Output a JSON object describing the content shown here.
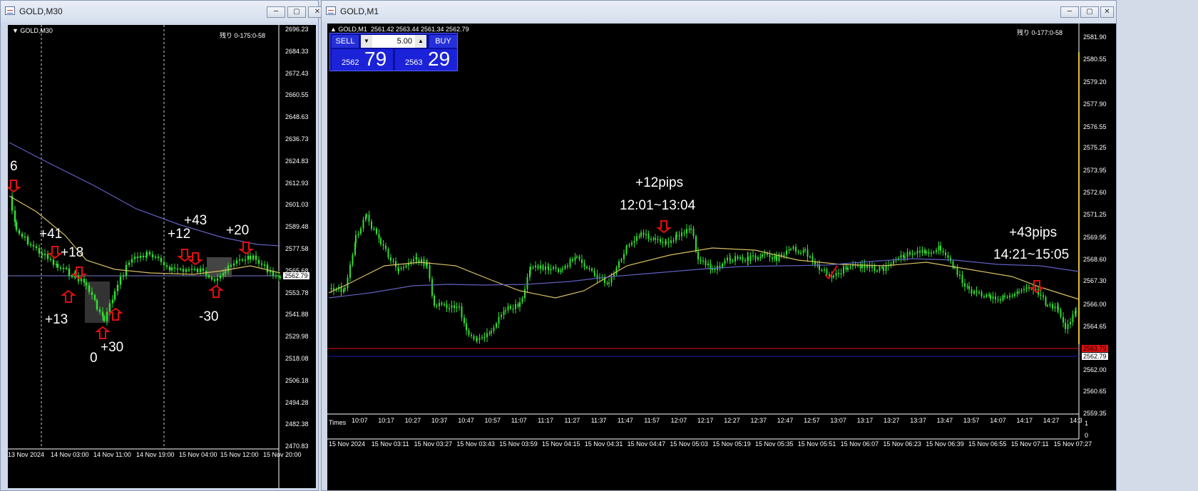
{
  "left_window": {
    "title": "GOLD,M30",
    "chart_label": "GOLD,M30",
    "remaining": "残り 0-175:0-58",
    "price_axis": [
      "2696.23",
      "2684.33",
      "2672.43",
      "2660.55",
      "2648.63",
      "2636.73",
      "2624.83",
      "2612.93",
      "2601.03",
      "2589.48",
      "2577.58",
      "2565.68",
      "2553.78",
      "2541.88",
      "2529.98",
      "2518.08",
      "2506.18",
      "2494.28",
      "2482.38",
      "2470.83"
    ],
    "current_price": "2562.79",
    "time_axis": [
      "13 Nov 2024",
      "14 Nov 03:00",
      "14 Nov 11:00",
      "14 Nov 19:00",
      "15 Nov 04:00",
      "15 Nov 12:00",
      "15 Nov 20:00"
    ],
    "annotations": [
      "6",
      "+41",
      "+18",
      "+13",
      "0",
      "+30",
      "+12",
      "+43",
      "+20",
      "-30"
    ]
  },
  "right_window": {
    "title": "GOLD,M1",
    "chart_label": "GOLD,M1",
    "ohlc": "2561.42 2563.44 2561.34 2562.79",
    "remaining": "残り 0-177:0-58",
    "trade_panel": {
      "sell_label": "SELL",
      "buy_label": "BUY",
      "lot": "5.00",
      "sell_big": "2562",
      "sell_pips": "79",
      "buy_big": "2563",
      "buy_pips": "29"
    },
    "price_axis": [
      "2581.90",
      "2580.55",
      "2579.20",
      "2577.90",
      "2576.55",
      "2575.25",
      "2573.95",
      "2572.60",
      "2571.25",
      "2569.95",
      "2568.60",
      "2567.30",
      "2566.00",
      "2564.65",
      "2563.79",
      "2562.79",
      "2562.00",
      "2560.65",
      "2559.35"
    ],
    "ask_price": "2563.79",
    "bid_price": "2562.79",
    "subwindow_label": "Times",
    "subwindow_axis": [
      "1",
      "0"
    ],
    "subtimes": [
      "10:07",
      "10:17",
      "10:27",
      "10:37",
      "10:47",
      "10:57",
      "11:07",
      "11:17",
      "11:27",
      "11:37",
      "11:47",
      "11:57",
      "12:07",
      "12:17",
      "12:27",
      "12:37",
      "12:47",
      "12:57",
      "13:07",
      "13:17",
      "13:27",
      "13:37",
      "13:47",
      "13:57",
      "14:07",
      "14:17",
      "14:27",
      "14:3"
    ],
    "time_axis": [
      "15 Nov 2024",
      "15 Nov 03:11",
      "15 Nov 03:27",
      "15 Nov 03:43",
      "15 Nov 03:59",
      "15 Nov 04:15",
      "15 Nov 04:31",
      "15 Nov 04:47",
      "15 Nov 05:03",
      "15 Nov 05:19",
      "15 Nov 05:35",
      "15 Nov 05:51",
      "15 Nov 06:07",
      "15 Nov 06:23",
      "15 Nov 06:39",
      "15 Nov 06:55",
      "15 Nov 07:11",
      "15 Nov 07:27"
    ],
    "annotations": {
      "trade1_pips": "+12pips",
      "trade1_time": "12:01~13:04",
      "trade2_pips": "+43pips",
      "trade2_time": "14:21~15:05"
    }
  },
  "colors": {
    "candle": "#33dd33",
    "ma_fast": "#d8c060",
    "ma_slow": "#6060c0",
    "arrow": "#e01010",
    "ask_line": "#e01010",
    "bid_line": "#1a1ab0"
  }
}
